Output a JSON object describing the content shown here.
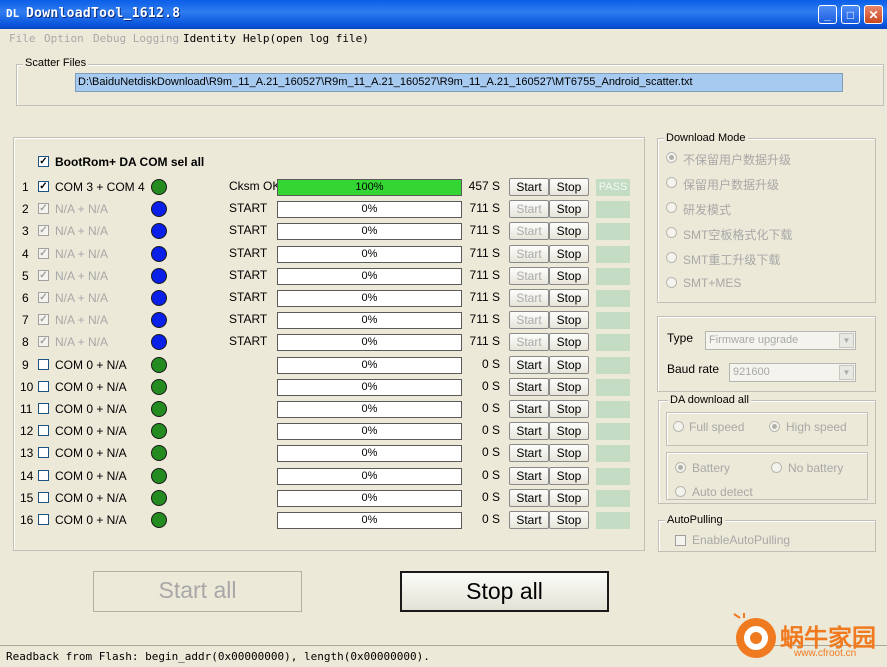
{
  "window": {
    "title": "DownloadTool_1612.8",
    "icon": "app-icon",
    "icon_text": "DL"
  },
  "menu": [
    {
      "label": "File",
      "enabled": false
    },
    {
      "label": "Option",
      "enabled": false
    },
    {
      "label": "Debug Logging",
      "enabled": false
    },
    {
      "label": "Identity",
      "enabled": true
    },
    {
      "label": "Help(open log file)",
      "enabled": true
    }
  ],
  "scatter": {
    "label": "Scatter Files",
    "path": "D:\\BaiduNetdiskDownload\\R9m_11_A.21_160527\\R9m_11_A.21_160527\\R9m_11_A.21_160527\\MT6755_Android_scatter.txt"
  },
  "select_all_label": "BootRom+ DA COM sel all",
  "rows": [
    {
      "index": "1",
      "checked": true,
      "enabled": true,
      "port": "COM 3 + COM 4",
      "dot": "green",
      "status": "Cksm OK",
      "progress": 100,
      "progress_text": "100%",
      "time": "457 S",
      "start": "Start",
      "stop": "Stop",
      "start_enabled": true,
      "result": "PASS"
    },
    {
      "index": "2",
      "checked": true,
      "enabled": false,
      "port": "N/A + N/A",
      "dot": "blue",
      "status": "START",
      "progress": 0,
      "progress_text": "0%",
      "time": "711 S",
      "start": "Start",
      "stop": "Stop",
      "start_enabled": false,
      "result": ""
    },
    {
      "index": "3",
      "checked": true,
      "enabled": false,
      "port": "N/A + N/A",
      "dot": "blue",
      "status": "START",
      "progress": 0,
      "progress_text": "0%",
      "time": "711 S",
      "start": "Start",
      "stop": "Stop",
      "start_enabled": false,
      "result": ""
    },
    {
      "index": "4",
      "checked": true,
      "enabled": false,
      "port": "N/A + N/A",
      "dot": "blue",
      "status": "START",
      "progress": 0,
      "progress_text": "0%",
      "time": "711 S",
      "start": "Start",
      "stop": "Stop",
      "start_enabled": false,
      "result": ""
    },
    {
      "index": "5",
      "checked": true,
      "enabled": false,
      "port": "N/A + N/A",
      "dot": "blue",
      "status": "START",
      "progress": 0,
      "progress_text": "0%",
      "time": "711 S",
      "start": "Start",
      "stop": "Stop",
      "start_enabled": false,
      "result": ""
    },
    {
      "index": "6",
      "checked": true,
      "enabled": false,
      "port": "N/A + N/A",
      "dot": "blue",
      "status": "START",
      "progress": 0,
      "progress_text": "0%",
      "time": "711 S",
      "start": "Start",
      "stop": "Stop",
      "start_enabled": false,
      "result": ""
    },
    {
      "index": "7",
      "checked": true,
      "enabled": false,
      "port": "N/A + N/A",
      "dot": "blue",
      "status": "START",
      "progress": 0,
      "progress_text": "0%",
      "time": "711 S",
      "start": "Start",
      "stop": "Stop",
      "start_enabled": false,
      "result": ""
    },
    {
      "index": "8",
      "checked": true,
      "enabled": false,
      "port": "N/A + N/A",
      "dot": "blue",
      "status": "START",
      "progress": 0,
      "progress_text": "0%",
      "time": "711 S",
      "start": "Start",
      "stop": "Stop",
      "start_enabled": false,
      "result": ""
    },
    {
      "index": "9",
      "checked": false,
      "enabled": true,
      "port": "COM 0 + N/A",
      "dot": "green",
      "status": "",
      "progress": 0,
      "progress_text": "0%",
      "time": "0 S",
      "start": "Start",
      "stop": "Stop",
      "start_enabled": true,
      "result": ""
    },
    {
      "index": "10",
      "checked": false,
      "enabled": true,
      "port": "COM 0 + N/A",
      "dot": "green",
      "status": "",
      "progress": 0,
      "progress_text": "0%",
      "time": "0 S",
      "start": "Start",
      "stop": "Stop",
      "start_enabled": true,
      "result": ""
    },
    {
      "index": "11",
      "checked": false,
      "enabled": true,
      "port": "COM 0 + N/A",
      "dot": "green",
      "status": "",
      "progress": 0,
      "progress_text": "0%",
      "time": "0 S",
      "start": "Start",
      "stop": "Stop",
      "start_enabled": true,
      "result": ""
    },
    {
      "index": "12",
      "checked": false,
      "enabled": true,
      "port": "COM 0 + N/A",
      "dot": "green",
      "status": "",
      "progress": 0,
      "progress_text": "0%",
      "time": "0 S",
      "start": "Start",
      "stop": "Stop",
      "start_enabled": true,
      "result": ""
    },
    {
      "index": "13",
      "checked": false,
      "enabled": true,
      "port": "COM 0 + N/A",
      "dot": "green",
      "status": "",
      "progress": 0,
      "progress_text": "0%",
      "time": "0 S",
      "start": "Start",
      "stop": "Stop",
      "start_enabled": true,
      "result": ""
    },
    {
      "index": "14",
      "checked": false,
      "enabled": true,
      "port": "COM 0 + N/A",
      "dot": "green",
      "status": "",
      "progress": 0,
      "progress_text": "0%",
      "time": "0 S",
      "start": "Start",
      "stop": "Stop",
      "start_enabled": true,
      "result": ""
    },
    {
      "index": "15",
      "checked": false,
      "enabled": true,
      "port": "COM 0 + N/A",
      "dot": "green",
      "status": "",
      "progress": 0,
      "progress_text": "0%",
      "time": "0 S",
      "start": "Start",
      "stop": "Stop",
      "start_enabled": true,
      "result": ""
    },
    {
      "index": "16",
      "checked": false,
      "enabled": true,
      "port": "COM 0 + N/A",
      "dot": "green",
      "status": "",
      "progress": 0,
      "progress_text": "0%",
      "time": "0 S",
      "start": "Start",
      "stop": "Stop",
      "start_enabled": true,
      "result": ""
    }
  ],
  "download_mode": {
    "label": "Download Mode",
    "options": [
      "不保留用户数据升级",
      "保留用户数据升级",
      "研发模式",
      "SMT空板格式化下载",
      "SMT重工升级下载",
      "SMT+MES"
    ],
    "selected": 0
  },
  "type": {
    "label": "Type",
    "value": "Firmware upgrade"
  },
  "baud": {
    "label": "Baud rate",
    "value": "921600"
  },
  "da_download": {
    "label": "DA download all",
    "speed_options": [
      "Full speed",
      "High speed"
    ],
    "speed_selected": 1,
    "battery_options": [
      "Battery",
      "No battery",
      "Auto detect"
    ],
    "battery_selected": 0
  },
  "autopulling": {
    "label": "AutoPulling",
    "checkbox_label": "EnableAutoPulling"
  },
  "buttons": {
    "start_all": "Start all",
    "stop_all": "Stop all"
  },
  "status_bar": "Readback from Flash:  begin_addr(0x00000000), length(0x00000000).",
  "watermark": {
    "text": "蜗牛家园",
    "url": "www.cfroot.cn",
    "icon": "snail-logo-icon"
  },
  "colors": {
    "title_bar": "#0a5ee8",
    "progress_fill": "#33d633",
    "dot_green": "#238b1f",
    "dot_blue": "#0a1fe8",
    "selection": "#a6caf0"
  }
}
